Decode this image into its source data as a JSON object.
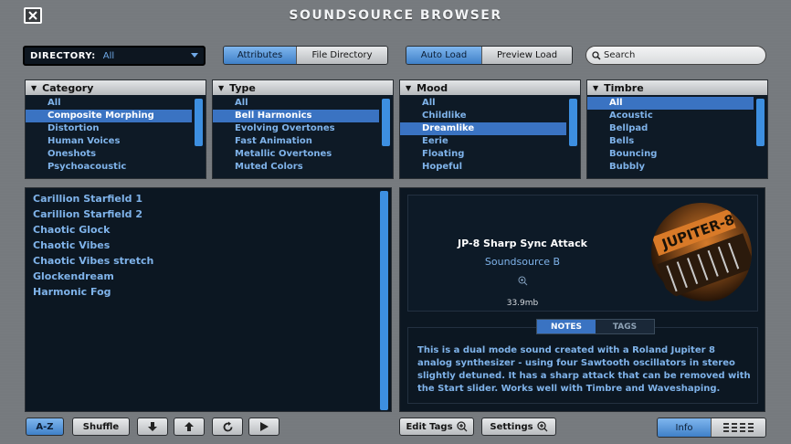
{
  "window": {
    "title": "SOUNDSOURCE BROWSER"
  },
  "directory": {
    "label": "DIRECTORY:",
    "value": "All"
  },
  "view_tabs": [
    {
      "label": "Attributes",
      "active": true
    },
    {
      "label": "File Directory",
      "active": false
    }
  ],
  "load_tabs": [
    {
      "label": "Auto Load",
      "active": true
    },
    {
      "label": "Preview Load",
      "active": false
    }
  ],
  "search": {
    "placeholder": "Search"
  },
  "filters": {
    "category": {
      "title": "Category",
      "items": [
        "All",
        "Composite Morphing",
        "Distortion",
        "Human Voices",
        "Oneshots",
        "Psychoacoustic"
      ],
      "selected": 1
    },
    "type": {
      "title": "Type",
      "items": [
        "All",
        "Bell Harmonics",
        "Evolving Overtones",
        "Fast Animation",
        "Metallic Overtones",
        "Muted Colors"
      ],
      "selected": 1
    },
    "mood": {
      "title": "Mood",
      "items": [
        "All",
        "Childlike",
        "Dreamlike",
        "Eerie",
        "Floating",
        "Hopeful"
      ],
      "selected": 2
    },
    "timbre": {
      "title": "Timbre",
      "items": [
        "All",
        "Acoustic",
        "Bellpad",
        "Bells",
        "Bouncing",
        "Bubbly"
      ],
      "selected": 0
    }
  },
  "results": [
    "Carillion Starfield 1",
    "Carillion Starfield 2",
    "Chaotic Glock",
    "Chaotic Vibes",
    "Chaotic Vibes stretch",
    "Glockendream",
    "Harmonic Fog"
  ],
  "info": {
    "name": "JP-8 Sharp Sync Attack",
    "source": "Soundsource B",
    "size": "33.9mb",
    "thumb_text": "JUPITER-8",
    "tabs": [
      {
        "label": "NOTES",
        "active": true
      },
      {
        "label": "TAGS",
        "active": false
      }
    ],
    "notes": "This is a dual mode sound created with a Roland Jupiter 8 analog synthesizer - using four Sawtooth oscillators in stereo slightly detuned. It has a sharp attack that can be removed with the Start slider. Works well with Timbre and Waveshaping."
  },
  "bottom": {
    "az": "A-Z",
    "shuffle": "Shuffle",
    "edit_tags": "Edit Tags",
    "settings": "Settings",
    "info": "Info"
  },
  "colors": {
    "accent": "#3a73c2",
    "list_text": "#7fb3ea",
    "panel_bg": "#0c1722"
  }
}
